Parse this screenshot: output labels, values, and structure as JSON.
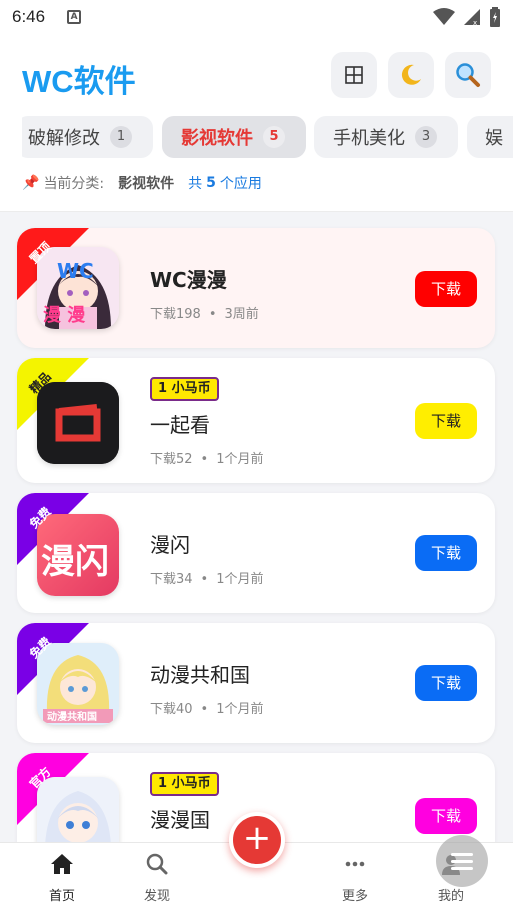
{
  "status_bar": {
    "time": "6:46",
    "notif_icon": "A"
  },
  "header": {
    "title": "WC软件",
    "buttons": [
      "grid-icon",
      "moon-icon",
      "search-icon"
    ]
  },
  "tabs": [
    {
      "label": "破解修改",
      "count": "1",
      "active": false
    },
    {
      "label": "影视软件",
      "count": "5",
      "active": true
    },
    {
      "label": "手机美化",
      "count": "3",
      "active": false
    },
    {
      "label": "娱",
      "count": "",
      "active": false
    }
  ],
  "info": {
    "pin_icon": "📌",
    "prefix": "当前分类:",
    "category": "影视软件",
    "total_prefix": "共",
    "total_count": "5",
    "total_suffix": "个应用"
  },
  "apps": [
    {
      "tag": "置顶",
      "tag_color": "#ff1a1a",
      "tag_text_color": "#ffffff",
      "name": "WC漫漫",
      "meta_downloads": "下载198",
      "meta_time": "3周前",
      "coin": "",
      "download": "下载",
      "btn_color": "#ff0000",
      "btn_text_color": "#ffffff",
      "icon": "anime-girl-icon",
      "icon_text": "WC",
      "icon_text2": "漫 漫"
    },
    {
      "tag": "精品",
      "tag_color": "#f4f400",
      "tag_text_color": "#222222",
      "name": "一起看",
      "meta_downloads": "下载52",
      "meta_time": "1个月前",
      "coin": "1 小马币",
      "download": "下载",
      "btn_color": "#ffee00",
      "btn_text_color": "#222222",
      "icon": "tv-icon"
    },
    {
      "tag": "免费",
      "tag_color": "#7a00e6",
      "tag_text_color": "#ffffff",
      "name": "漫闪",
      "meta_downloads": "下载34",
      "meta_time": "1个月前",
      "coin": "",
      "download": "下载",
      "btn_color": "#0a6cf5",
      "btn_text_color": "#ffffff",
      "icon": "manshan-icon",
      "icon_text": "漫闪"
    },
    {
      "tag": "免费",
      "tag_color": "#7a00e6",
      "tag_text_color": "#ffffff",
      "name": "动漫共和国",
      "meta_downloads": "下载40",
      "meta_time": "1个月前",
      "coin": "",
      "download": "下载",
      "btn_color": "#0a6cf5",
      "btn_text_color": "#ffffff",
      "icon": "anime-boy-icon",
      "icon_text": "动漫共和国"
    },
    {
      "tag": "官方",
      "tag_color": "#ff00e0",
      "tag_text_color": "#ffffff",
      "name": "漫漫国",
      "meta_downloads": "",
      "meta_time": "",
      "coin": "1 小马币",
      "download": "下载",
      "btn_color": "#ff00e0",
      "btn_text_color": "#ffffff",
      "icon": "anime-girl-2-icon"
    }
  ],
  "nav": {
    "home": "首页",
    "discover": "发现",
    "more": "更多",
    "mine": "我的",
    "fab": "+"
  }
}
